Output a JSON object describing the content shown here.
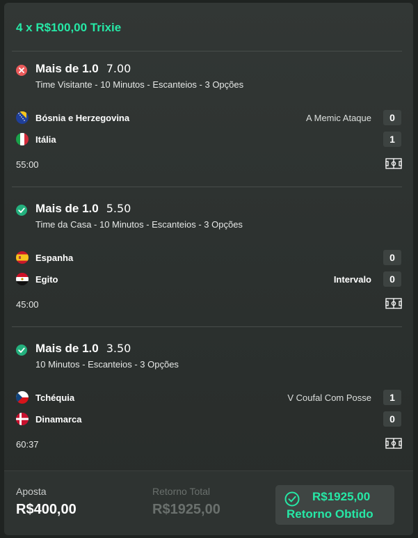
{
  "bet": {
    "title": "4 x R$100,00 Trixie"
  },
  "selections": [
    {
      "status": "lost",
      "market": "Mais de 1.0",
      "odds": "7.00",
      "description": "Time Visitante - 10 Minutos - Escanteios - 3 Opções",
      "home": {
        "name": "Bósnia e Herzegovina",
        "event": "A Memic Ataque",
        "score": "0"
      },
      "away": {
        "name": "Itália",
        "event": "",
        "score": "1"
      },
      "clock": "55:00"
    },
    {
      "status": "won",
      "market": "Mais de 1.0",
      "odds": "5.50",
      "description": "Time da Casa - 10 Minutos - Escanteios - 3 Opções",
      "home": {
        "name": "Espanha",
        "event": "",
        "score": "0"
      },
      "away": {
        "name": "Egito",
        "event": "Intervalo",
        "score": "0"
      },
      "clock": "45:00"
    },
    {
      "status": "won",
      "market": "Mais de 1.0",
      "odds": "3.50",
      "description": "10 Minutos - Escanteios - 3 Opções",
      "home": {
        "name": "Tchéquia",
        "event": "V Coufal Com Posse",
        "score": "1"
      },
      "away": {
        "name": "Dinamarca",
        "event": "",
        "score": "0"
      },
      "clock": "60:37"
    }
  ],
  "footer": {
    "stake_label": "Aposta",
    "stake_value": "R$400,00",
    "total_return_label": "Retorno Total",
    "total_return_value": "R$1925,00",
    "obtained_amount": "R$1925,00",
    "obtained_label": "Retorno Obtido"
  },
  "colors": {
    "accent": "#26e8a6",
    "won": "#23b07d",
    "lost": "#ea5a5a",
    "card_bg": "#323735"
  },
  "icons": {
    "lost": "x-circle-icon",
    "won": "check-circle-icon",
    "pitch": "pitch-icon",
    "obtained": "check-circle-outline-icon"
  }
}
